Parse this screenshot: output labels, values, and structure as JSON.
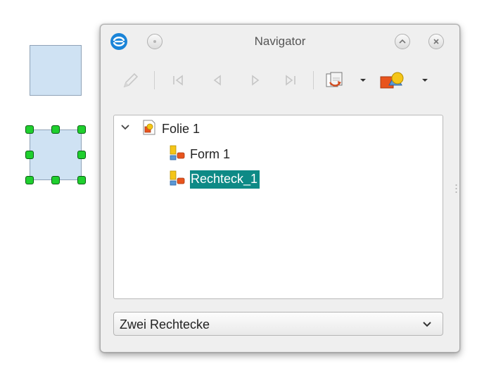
{
  "window": {
    "title": "Navigator"
  },
  "toolbar": {
    "buttons": [
      {
        "name": "edit",
        "icon": "pencil-icon",
        "enabled": false
      },
      {
        "name": "first",
        "icon": "first-icon",
        "enabled": false
      },
      {
        "name": "previous",
        "icon": "previous-icon",
        "enabled": false
      },
      {
        "name": "next",
        "icon": "next-icon",
        "enabled": false
      },
      {
        "name": "last",
        "icon": "last-icon",
        "enabled": false
      },
      {
        "name": "drag-mode",
        "icon": "drag-mode-icon",
        "enabled": true
      },
      {
        "name": "shapes",
        "icon": "shapes-icon",
        "enabled": true
      }
    ]
  },
  "tree": {
    "items": [
      {
        "label": "Folie 1",
        "icon": "slide-icon",
        "expanded": true,
        "level": 0
      },
      {
        "label": "Form 1",
        "icon": "shape-icon",
        "level": 1
      },
      {
        "label": "Rechteck_1",
        "icon": "shape-icon",
        "level": 1,
        "selected": true
      }
    ]
  },
  "document_select": {
    "value": "Zwei Rechtecke"
  },
  "colors": {
    "selection": "#0e8a86",
    "handle": "#1fcf2e",
    "shape_fill": "#cfe2f3"
  }
}
